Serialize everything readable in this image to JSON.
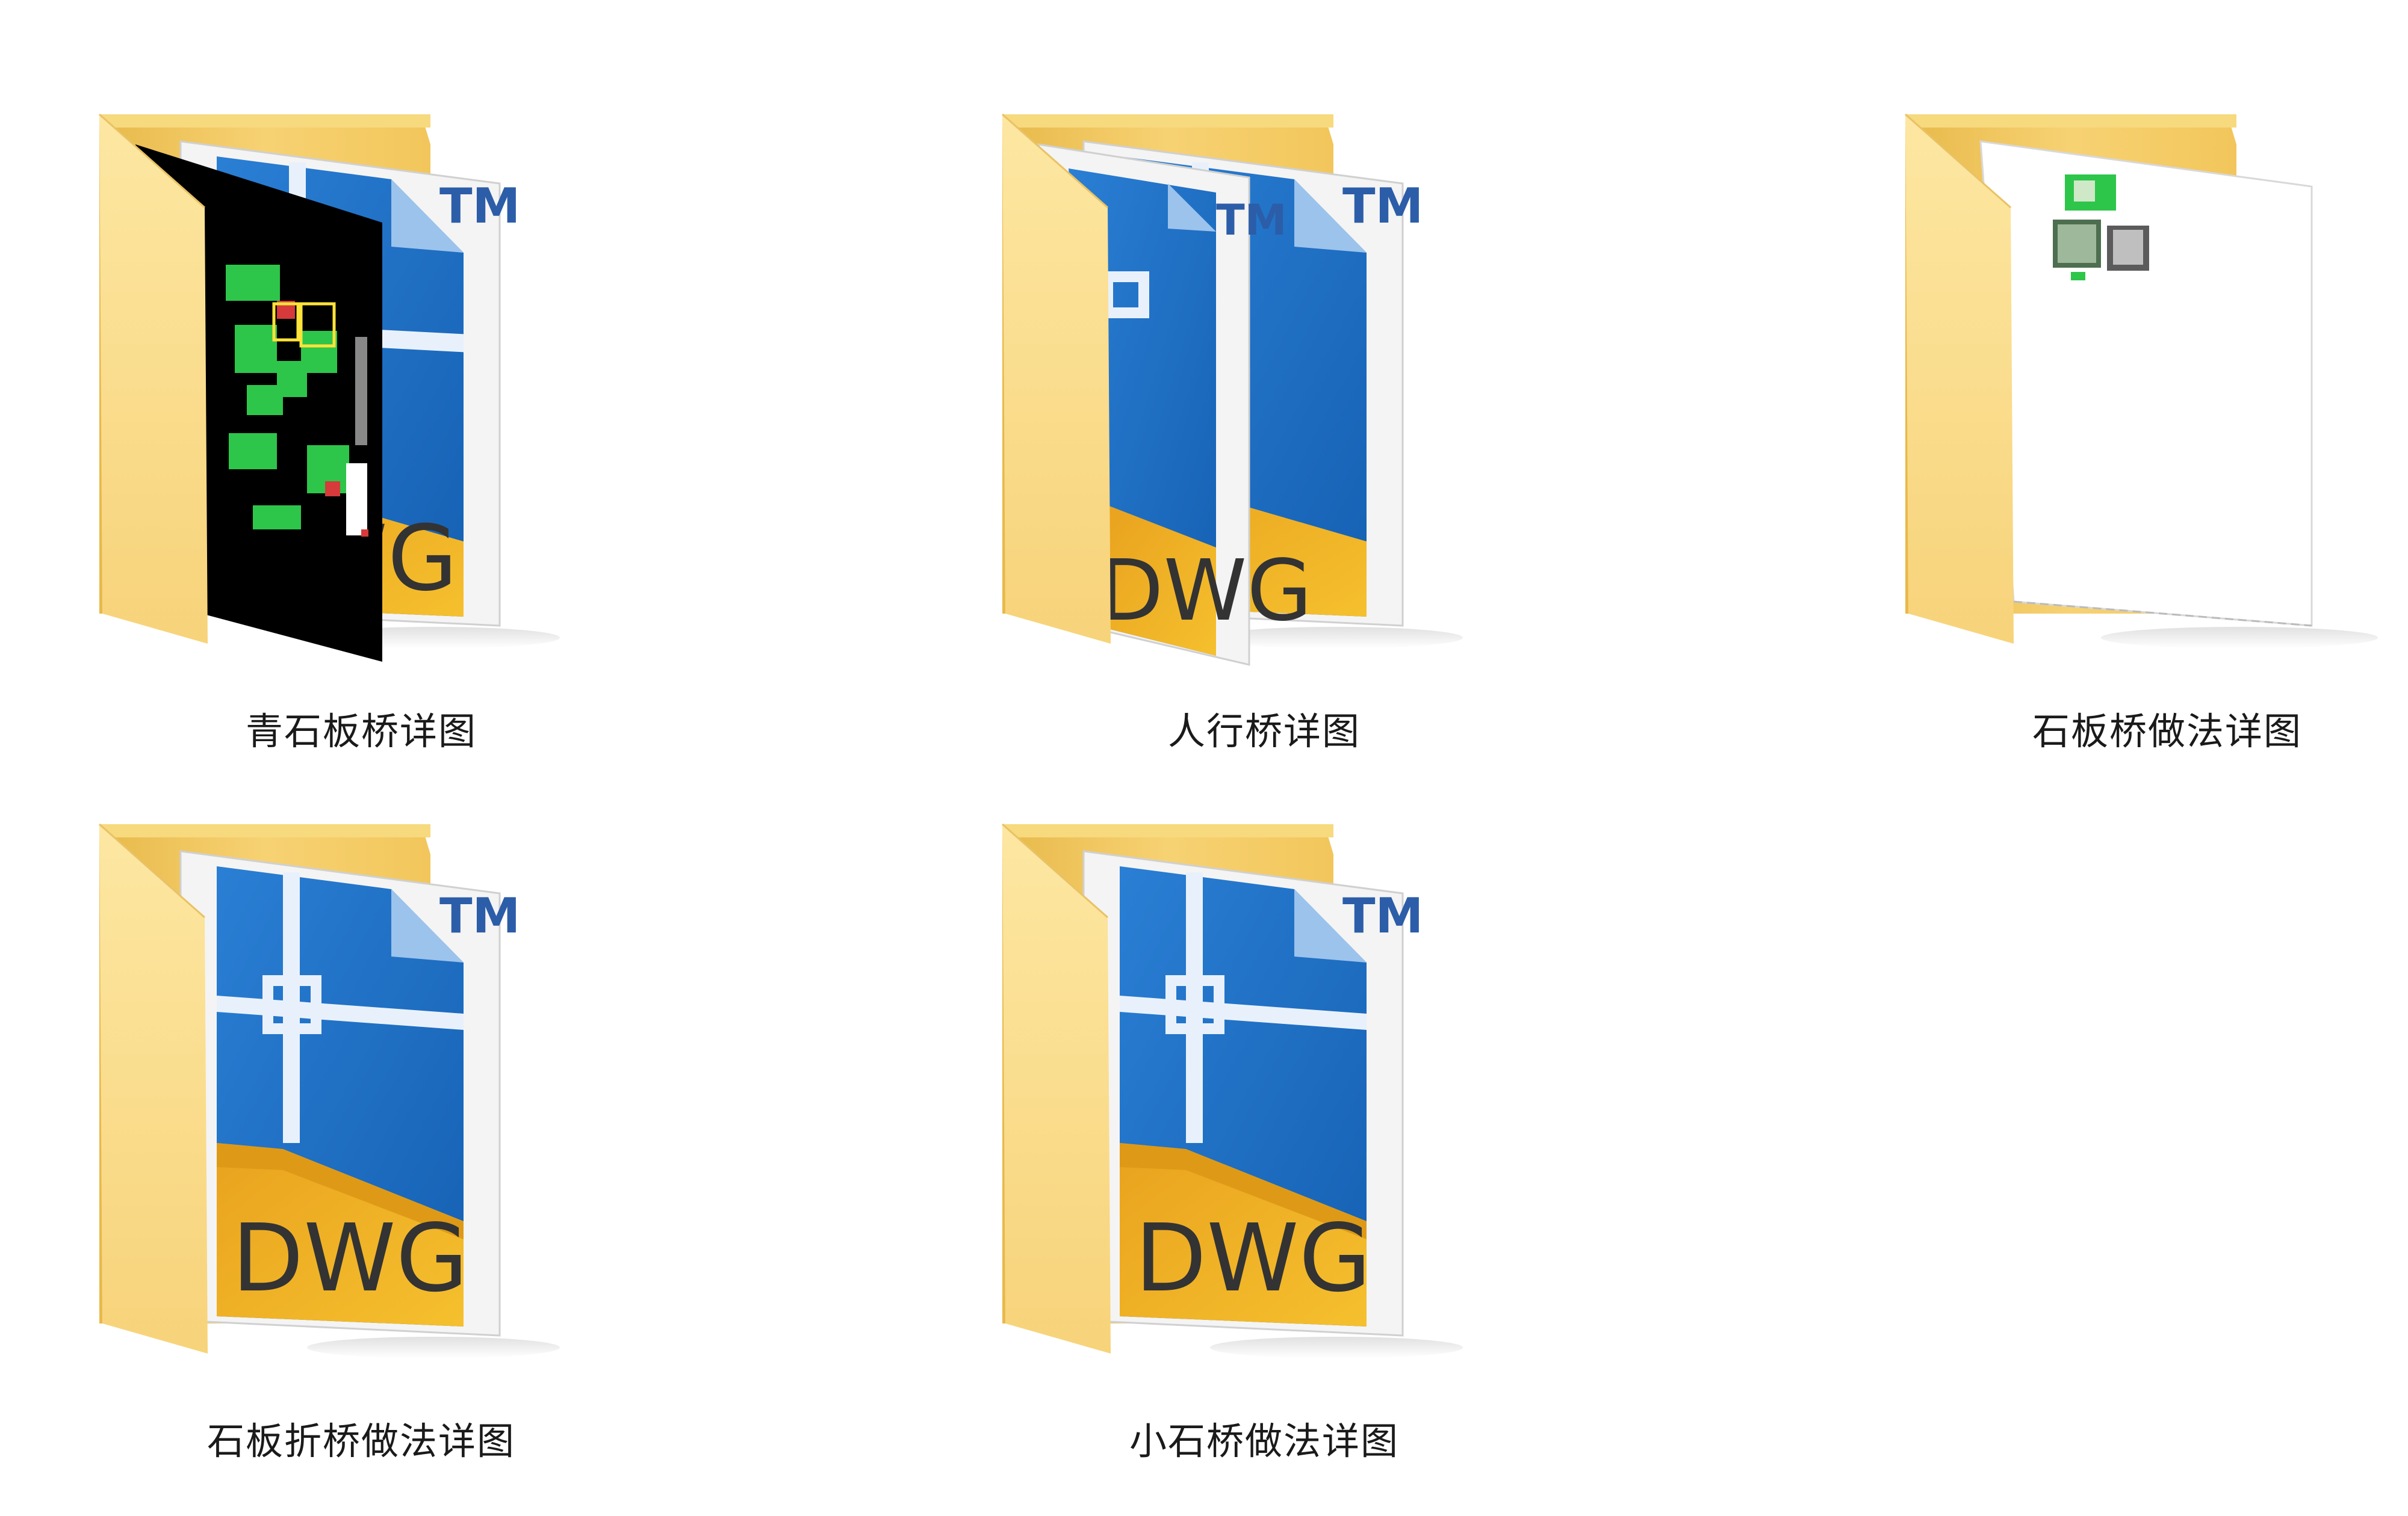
{
  "folders": [
    {
      "name": "青石板桥详图",
      "preview": "black-cad-and-dwg"
    },
    {
      "name": "人行桥详图",
      "preview": "dwg-and-dwg"
    },
    {
      "name": "石板桥做法详图",
      "preview": "white-thumbnail"
    },
    {
      "name": "石板折桥做法详图",
      "preview": "dwg"
    },
    {
      "name": "小石桥做法详图",
      "preview": "dwg"
    }
  ],
  "dwg_text": "DWG",
  "tm_text": "TM",
  "colors": {
    "folder_back": "#F3C85E",
    "folder_front": "#FBE08F",
    "dwg_blue": "#1F74C8",
    "dwg_yellow": "#F0B324",
    "tm_blue": "#2C5DA8"
  }
}
